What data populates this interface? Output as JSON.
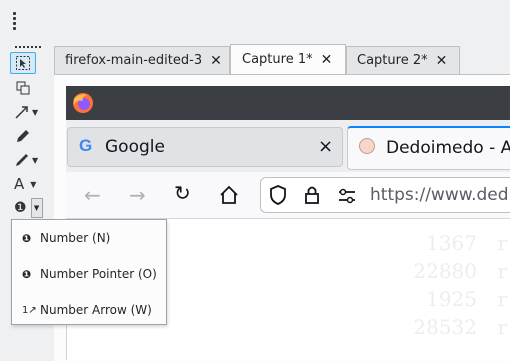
{
  "editor_tabs": [
    {
      "label": "firefox-main-edited-3",
      "close": "✕"
    },
    {
      "label": "Capture 1*",
      "close": "✕"
    },
    {
      "label": "Capture 2*",
      "close": "✕"
    }
  ],
  "firefox": {
    "tab1_label": "Google",
    "tab1_close": "×",
    "tab2_label": "Dedoimedo - A",
    "url": "https://www.ded",
    "bg_numbers": [
      "1367",
      "22880",
      "1925",
      "28532"
    ],
    "bg_suffix": "r"
  },
  "menu": {
    "items": [
      {
        "icon": "❶",
        "label": "Number (N)"
      },
      {
        "icon": "❶",
        "label": "Number Pointer (O)"
      },
      {
        "icon": "1↗",
        "label": "Number Arrow (W)"
      }
    ]
  },
  "colors": {
    "accent": "#3daee9",
    "firefox_tab_accent": "#0a84ff",
    "toolbar_bg": "#eff0f1"
  }
}
